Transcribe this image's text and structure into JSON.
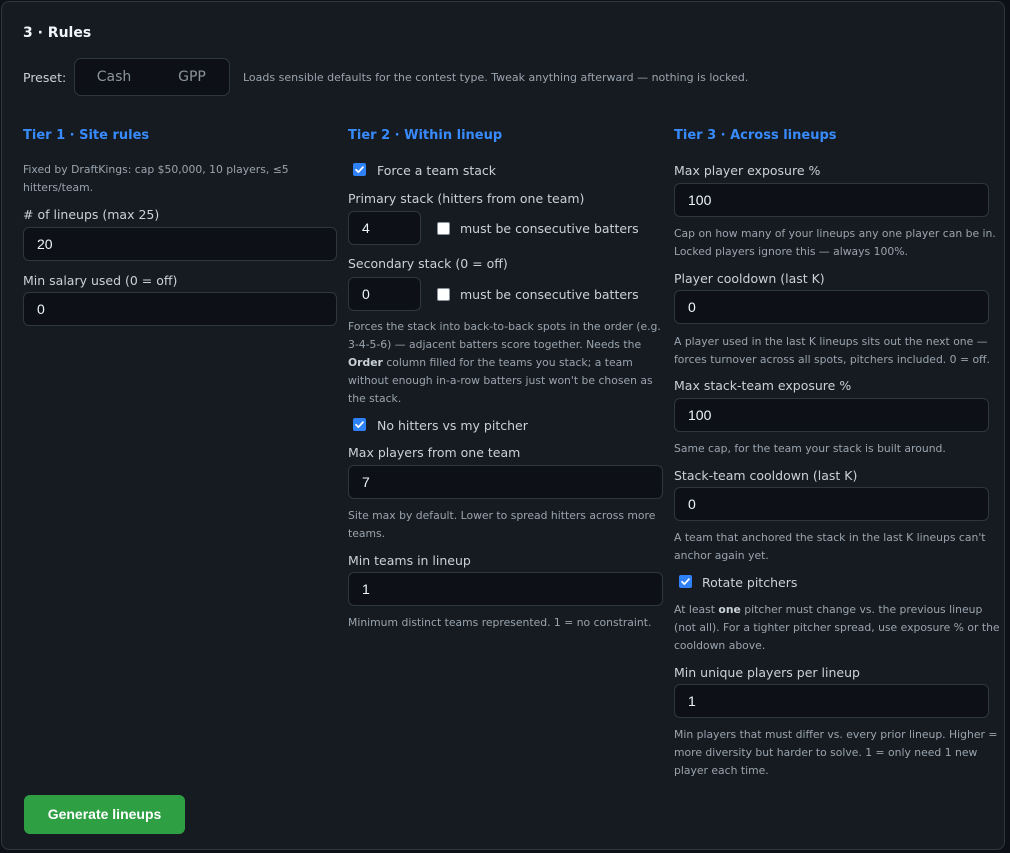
{
  "section_title": "3 · Rules",
  "preset": {
    "label": "Preset:",
    "options": [
      "Cash",
      "GPP"
    ],
    "note": "Loads sensible defaults for the contest type. Tweak anything afterward — nothing is locked."
  },
  "tier1": {
    "heading": "Tier 1 · Site rules",
    "fixed_note_line1": "Fixed by DraftKings: cap $50,000, 10 players, ≤5",
    "fixed_note_line2": "hitters/team.",
    "lineups_label": "# of lineups (max 25)",
    "lineups_value": "20",
    "min_salary_label": "Min salary used (0 = off)",
    "min_salary_value": "0"
  },
  "tier2": {
    "heading": "Tier 2 · Within lineup",
    "force_stack_label": "Force a team stack",
    "force_stack_checked": true,
    "primary_label": "Primary stack (hitters from one team)",
    "primary_value": "4",
    "consecutive_label": "must be consecutive batters",
    "secondary_label": "Secondary stack (0 = off)",
    "secondary_value": "0",
    "consecutive_label2": "must be consecutive batters",
    "stack_help_l1": "Forces the stack into back-to-back spots in the order (e.g.",
    "stack_help_l2": "3-4-5-6) — adjacent batters score together. Needs the",
    "stack_help_bold": "Order",
    "stack_help_l3_rest": " column filled for the teams you stack; a team",
    "stack_help_l4": "without enough in-a-row batters just won't be chosen as",
    "stack_help_l5": "the stack.",
    "no_hitters_label": "No hitters vs my pitcher",
    "max_team_label": "Max players from one team",
    "max_team_value": "7",
    "max_team_help_l1": "Site max by default. Lower to spread hitters across more",
    "max_team_help_l2": "teams.",
    "min_teams_label": "Min teams in lineup",
    "min_teams_value": "1",
    "min_teams_help": "Minimum distinct teams represented. 1 = no constraint."
  },
  "tier3": {
    "heading": "Tier 3 · Across lineups",
    "max_exposure_label": "Max player exposure %",
    "max_exposure_value": "100",
    "exposure_help_l1": "Cap on how many of your lineups any one player can be in.",
    "exposure_help_l2": "Locked players ignore this — always 100%.",
    "cooldown_label": "Player cooldown (last K)",
    "cooldown_value": "0",
    "cooldown_help_l1": "A player used in the last K lineups sits out the next one —",
    "cooldown_help_l2": "forces turnover across all spots, pitchers included. 0 = off.",
    "stack_exposure_label": "Max stack-team exposure %",
    "stack_exposure_value": "100",
    "stack_exposure_help": "Same cap, for the team your stack is built around.",
    "stack_cooldown_label": "Stack-team cooldown (last K)",
    "stack_cooldown_value": "0",
    "stack_cooldown_help_l1": "A team that anchored the stack in the last K lineups can't",
    "stack_cooldown_help_l2": "anchor again yet.",
    "rotate_label": "Rotate pitchers",
    "rotate_help_l1_pre": "At least ",
    "rotate_help_bold": "one",
    "rotate_help_l1_post": " pitcher must change vs. the previous lineup",
    "rotate_help_l2": "(not all). For a tighter pitcher spread, use exposure % or the",
    "rotate_help_l3": "cooldown above.",
    "min_unique_label": "Min unique players per lineup",
    "min_unique_value": "1",
    "min_unique_help_l1": "Min players that must differ vs. every prior lineup. Higher =",
    "min_unique_help_l2": "more diversity but harder to solve. 1 = only need 1 new",
    "min_unique_help_l3": "player each time."
  },
  "generate_label": "Generate lineups",
  "colors": {
    "accent": "#388bfd",
    "check": "#2f81f7",
    "generate": "#2ea043",
    "panel": "#161b22"
  },
  "icons": {
    "checked": "check-icon"
  }
}
